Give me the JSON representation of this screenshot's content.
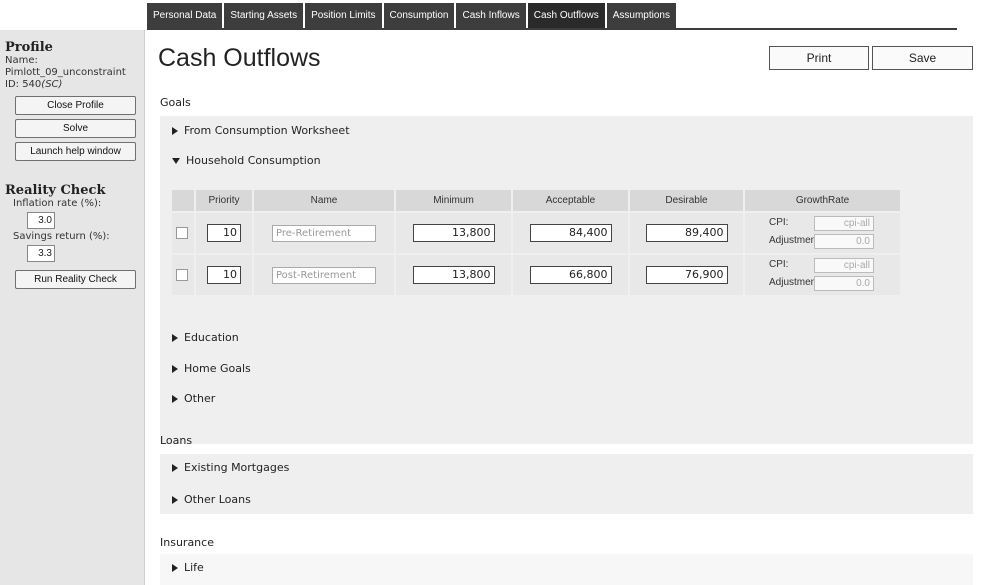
{
  "tabs": [
    {
      "label": "Personal Data"
    },
    {
      "label": "Starting Assets"
    },
    {
      "label": "Position Limits"
    },
    {
      "label": "Consumption"
    },
    {
      "label": "Cash Inflows"
    },
    {
      "label": "Cash Outflows"
    },
    {
      "label": "Assumptions"
    }
  ],
  "sidebar": {
    "profile_heading": "Profile",
    "name_label": "Name:",
    "name_value": "Pimlott_09_unconstraint",
    "id_label": "ID: 540",
    "id_suffix": "(SC)",
    "close_profile": "Close Profile",
    "solve": "Solve",
    "launch_help": "Launch help window",
    "reality_heading": "Reality Check",
    "inflation_label": "Inflation rate (%):",
    "inflation_value": "3.0",
    "savings_label": "Savings return (%):",
    "savings_value": "3.3",
    "run_reality": "Run Reality Check"
  },
  "main": {
    "title": "Cash Outflows",
    "print_label": "Print",
    "save_label": "Save",
    "goals_label": "Goals",
    "from_consumption": "From Consumption Worksheet",
    "household_consumption": "Household Consumption",
    "education": "Education",
    "home_goals": "Home Goals",
    "other": "Other",
    "loans_label": "Loans",
    "existing_mortgages": "Existing Mortgages",
    "other_loans": "Other Loans",
    "insurance_label": "Insurance",
    "life": "Life"
  },
  "goals_table": {
    "headers": [
      "Priority",
      "Name",
      "Minimum",
      "Acceptable",
      "Desirable",
      "GrowthRate"
    ],
    "rows": [
      {
        "priority": "10",
        "name": "Pre-Retirement",
        "minimum": "13,800",
        "acceptable": "84,400",
        "desirable": "89,400",
        "cpi_label": "CPI:",
        "cpi_value": "cpi-all",
        "adj_label": "Adjustment%:",
        "adj_value": "0.0"
      },
      {
        "priority": "10",
        "name": "Post-Retirement",
        "minimum": "13,800",
        "acceptable": "66,800",
        "desirable": "76,900",
        "cpi_label": "CPI:",
        "cpi_value": "cpi-all",
        "adj_label": "Adjustment%:",
        "adj_value": "0.0"
      }
    ]
  },
  "colors": {
    "tab_bg": "#3d3d3d",
    "sidebar_bg": "#e6e6e6",
    "panel_bg": "#efefef"
  }
}
